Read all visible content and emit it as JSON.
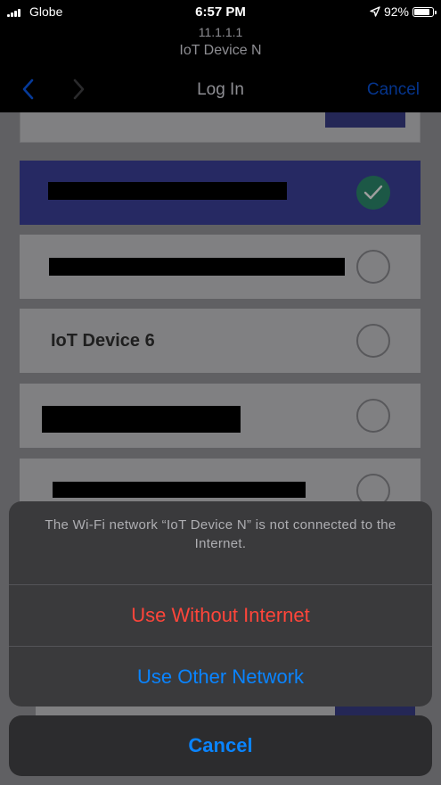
{
  "status_bar": {
    "carrier": "Globe",
    "time": "6:57 PM",
    "battery_text": "92%",
    "battery_level": 0.92,
    "icons": [
      "signal-bars-icon",
      "location-arrow-icon",
      "battery-icon"
    ]
  },
  "nav": {
    "url": "11.1.1.1",
    "page_name": "IoT Device N",
    "title": "Log In",
    "cancel_label": "Cancel",
    "icons": [
      "back-chevron-icon",
      "forward-chevron-icon"
    ]
  },
  "networks": [
    {
      "name": "",
      "selected": true,
      "redacted": true
    },
    {
      "name": "",
      "selected": false,
      "redacted": true
    },
    {
      "name": "IoT Device 6",
      "selected": false,
      "redacted": false
    },
    {
      "name": "",
      "selected": false,
      "redacted": true
    },
    {
      "name": "",
      "selected": false,
      "redacted": true
    }
  ],
  "action_sheet": {
    "message": "The Wi-Fi network “IoT Device N” is not connected to the Internet.",
    "actions": [
      {
        "label": "Use Without Internet",
        "style": "destructive"
      },
      {
        "label": "Use Other Network",
        "style": "default"
      }
    ],
    "cancel_label": "Cancel"
  },
  "colors": {
    "accent_blue": "#0a84ff",
    "destructive_red": "#ff453a",
    "selected_row": "#3e43a0",
    "check_green": "#2e8f72"
  }
}
